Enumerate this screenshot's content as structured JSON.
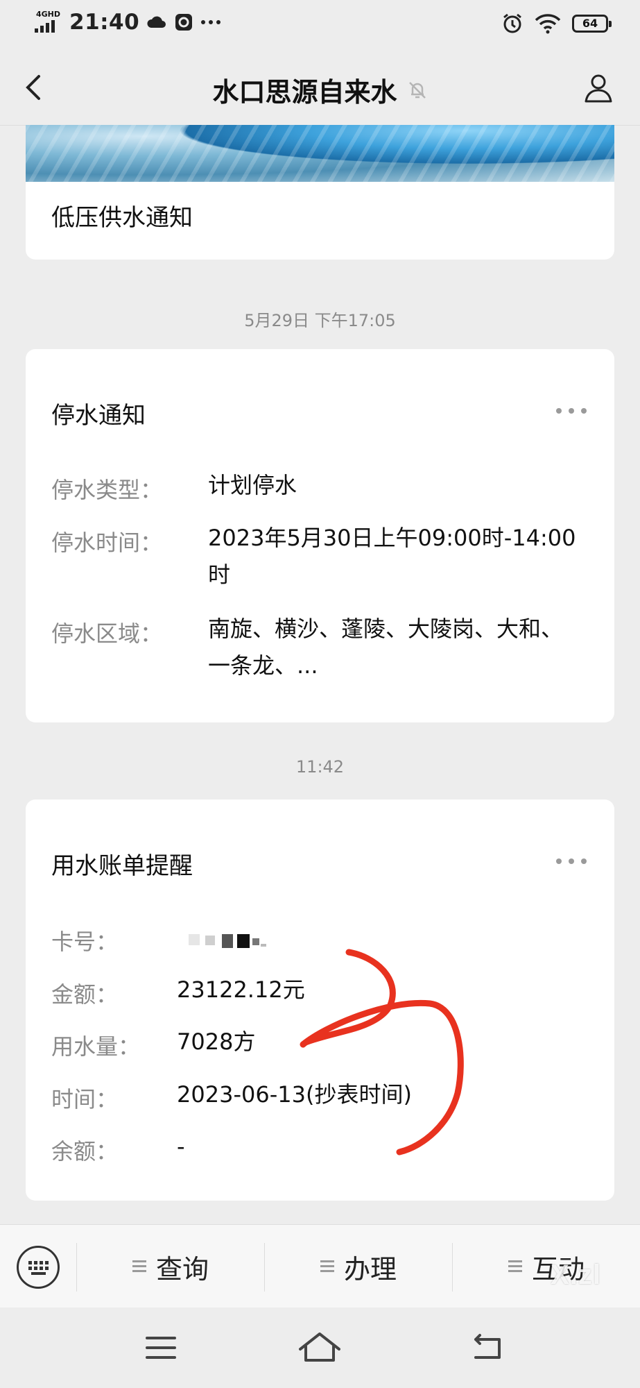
{
  "status_bar": {
    "network": "4GHD",
    "time": "21:40",
    "battery": "64",
    "icons": [
      "cloud-icon",
      "app-icon",
      "more-icon",
      "alarm-icon",
      "wifi-icon",
      "battery-icon"
    ]
  },
  "header": {
    "title": "水口思源自来水",
    "muted_icon": "bell-off-icon",
    "back_icon": "chevron-left-icon",
    "profile_icon": "user-icon"
  },
  "messages": [
    {
      "title": "低压供水通知"
    },
    {
      "timestamp": "5月29日 下午17:05",
      "title": "停水通知",
      "rows": [
        {
          "label": "停水类型：",
          "value": "计划停水"
        },
        {
          "label": "停水时间：",
          "value": "2023年5月30日上午09:00时-14:00时"
        },
        {
          "label": "停水区域：",
          "value": "南旋、横沙、蓬陵、大陵岗、大和、一条龙、..."
        }
      ]
    },
    {
      "timestamp": "11:42",
      "title": "用水账单提醒",
      "rows": [
        {
          "label": "卡号：",
          "value": ""
        },
        {
          "label": "金额：",
          "value": "23122.12元"
        },
        {
          "label": "用水量：",
          "value": "7028方"
        },
        {
          "label": "时间：",
          "value": "2023-06-13(抄表时间)"
        },
        {
          "label": "余额：",
          "value": "-"
        }
      ]
    }
  ],
  "menu": {
    "items": [
      {
        "label": "查询"
      },
      {
        "label": "办理"
      },
      {
        "label": "互动"
      }
    ],
    "keyboard_icon": "keyboard-icon"
  },
  "watermark": "X.zl",
  "colors": {
    "background": "#ededed",
    "card": "#ffffff",
    "annotation": "#e8321f"
  }
}
